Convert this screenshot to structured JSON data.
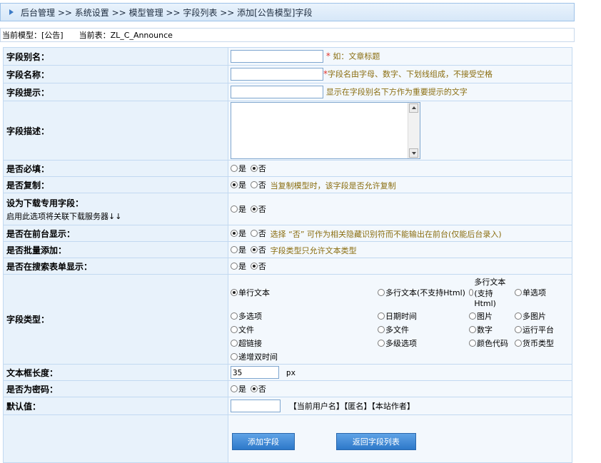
{
  "breadcrumb": [
    "后台管理",
    "系统设置",
    "模型管理",
    "字段列表",
    "添加[公告模型]字段"
  ],
  "breadcrumb_sep": ">>",
  "info": {
    "current_model": "当前模型：[公告]",
    "current_table": "当前表：ZL_C_Announce"
  },
  "fields": {
    "alias": {
      "label": "字段别名：",
      "value": "",
      "star": "*",
      "hint": " 如：文章标题"
    },
    "name": {
      "label": "字段名称：",
      "value": "",
      "star": "*",
      "hint": "字段名由字母、数字、下划线组成，不接受空格"
    },
    "tip": {
      "label": "字段提示：",
      "value": "",
      "hint": "显示在字段别名下方作为重要提示的文字"
    },
    "desc": {
      "label": "字段描述：",
      "value": ""
    },
    "required": {
      "label": "是否必填：",
      "opt_yes": "是",
      "opt_no": "否",
      "selected": "否"
    },
    "copy": {
      "label": "是否复制：",
      "opt_yes": "是",
      "opt_no": "否",
      "selected": "是",
      "hint": "当复制模型时，该字段是否允许复制"
    },
    "download": {
      "label": "设为下载专用字段：",
      "sub": "启用此选项将关联下载服务器↓↓",
      "opt_yes": "是",
      "opt_no": "否",
      "selected": "否"
    },
    "front": {
      "label": "是否在前台显示：",
      "opt_yes": "是",
      "opt_no": "否",
      "selected": "是",
      "hint": " 选择 “否” 可作为相关隐藏识别符而不能输出在前台(仅能后台录入)"
    },
    "batch": {
      "label": "是否批量添加：",
      "opt_yes": "是",
      "opt_no": "否",
      "selected": "否",
      "hint": "字段类型只允许文本类型"
    },
    "search": {
      "label": "是否在搜索表单显示：",
      "opt_yes": "是",
      "opt_no": "否",
      "selected": "否"
    },
    "type": {
      "label": "字段类型：",
      "options": [
        "单行文本",
        "多行文本(不支持Html)",
        "多行文本(支持Html)",
        "单选项",
        "多选项",
        "日期时间",
        "图片",
        "多图片",
        "文件",
        "多文件",
        "数字",
        "运行平台",
        "超链接",
        "多级选项",
        "颜色代码",
        "货币类型",
        "递增双时间"
      ],
      "selected": "单行文本"
    },
    "length": {
      "label": "文本框长度：",
      "value": "35",
      "unit": "px"
    },
    "password": {
      "label": "是否为密码：",
      "opt_yes": "是",
      "opt_no": "否",
      "selected": "否"
    },
    "default": {
      "label": "默认值：",
      "value": "",
      "links": "【当前用户名】【匿名】【本站作者】"
    }
  },
  "buttons": {
    "add": "添加字段",
    "back": "返回字段列表"
  }
}
